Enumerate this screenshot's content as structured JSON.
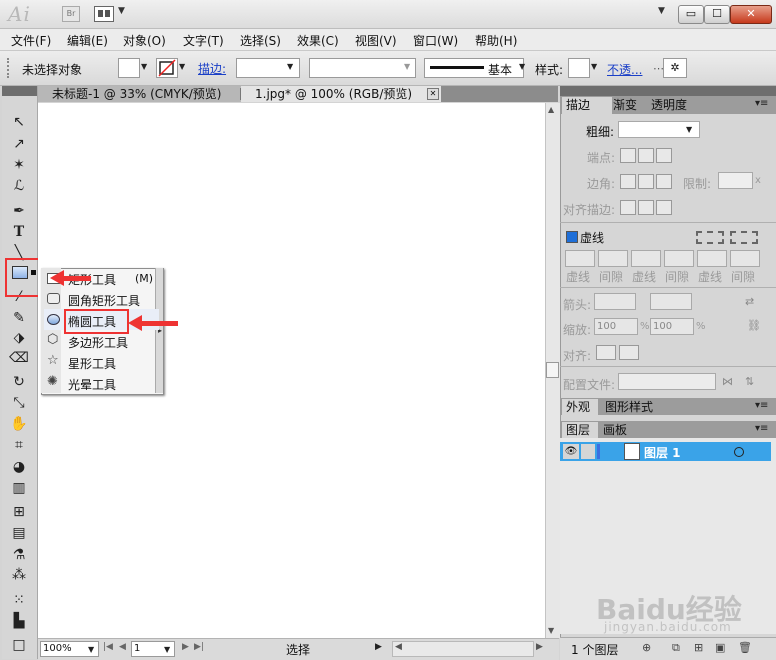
{
  "app": {
    "logo": "Ai",
    "bridge": "Br"
  },
  "window": {
    "minimize": "▭",
    "maximize": "☐",
    "close": "✕"
  },
  "menu": [
    "文件(F)",
    "编辑(E)",
    "对象(O)",
    "文字(T)",
    "选择(S)",
    "效果(C)",
    "视图(V)",
    "窗口(W)",
    "帮助(H)"
  ],
  "control": {
    "selection": "未选择对象",
    "stroke_label": "描边:",
    "brush_label": "基本",
    "style_label": "样式:",
    "opacity_label": "不透..."
  },
  "tabs": [
    {
      "label": "未标题-1 @ 33% (CMYK/预览)"
    },
    {
      "label": "1.jpg* @ 100% (RGB/预览)"
    }
  ],
  "flyout": {
    "items": [
      {
        "label": "矩形工具",
        "shortcut": "(M)"
      },
      {
        "label": "圆角矩形工具"
      },
      {
        "label": "椭圆工具"
      },
      {
        "label": "多边形工具"
      },
      {
        "label": "星形工具"
      },
      {
        "label": "光晕工具"
      }
    ]
  },
  "stroke_panel": {
    "tabs": [
      "描边",
      "渐变",
      "透明度"
    ],
    "weight_label": "粗细:",
    "cap_label": "端点:",
    "corner_label": "边角:",
    "limit_label": "限制:",
    "limit_suffix": "x",
    "align_label": "对齐描边:",
    "dashed_label": "虚线",
    "dash_labels": [
      "虚线",
      "间隙",
      "虚线",
      "间隙",
      "虚线",
      "间隙"
    ],
    "arrow_label": "箭头:",
    "scale_label": "缩放:",
    "scale_values": [
      "100",
      "100"
    ],
    "percent": "%",
    "align2_label": "对齐:",
    "profile_label": "配置文件:"
  },
  "appearance_panel": {
    "tabs": [
      "外观",
      "图形样式"
    ]
  },
  "layers_panel": {
    "tabs": [
      "图层",
      "画板"
    ],
    "layers": [
      {
        "name": "图层 1"
      }
    ],
    "count": "1 个图层"
  },
  "status": {
    "zoom": "100%",
    "page": "1",
    "mode": "选择"
  },
  "watermark": {
    "main": "Baidu经验",
    "sub": "jingyan.baidu.com"
  },
  "colors": {
    "highlight": "#e33333",
    "layer_select": "#3aa3e8",
    "link": "#1a3fc7"
  }
}
